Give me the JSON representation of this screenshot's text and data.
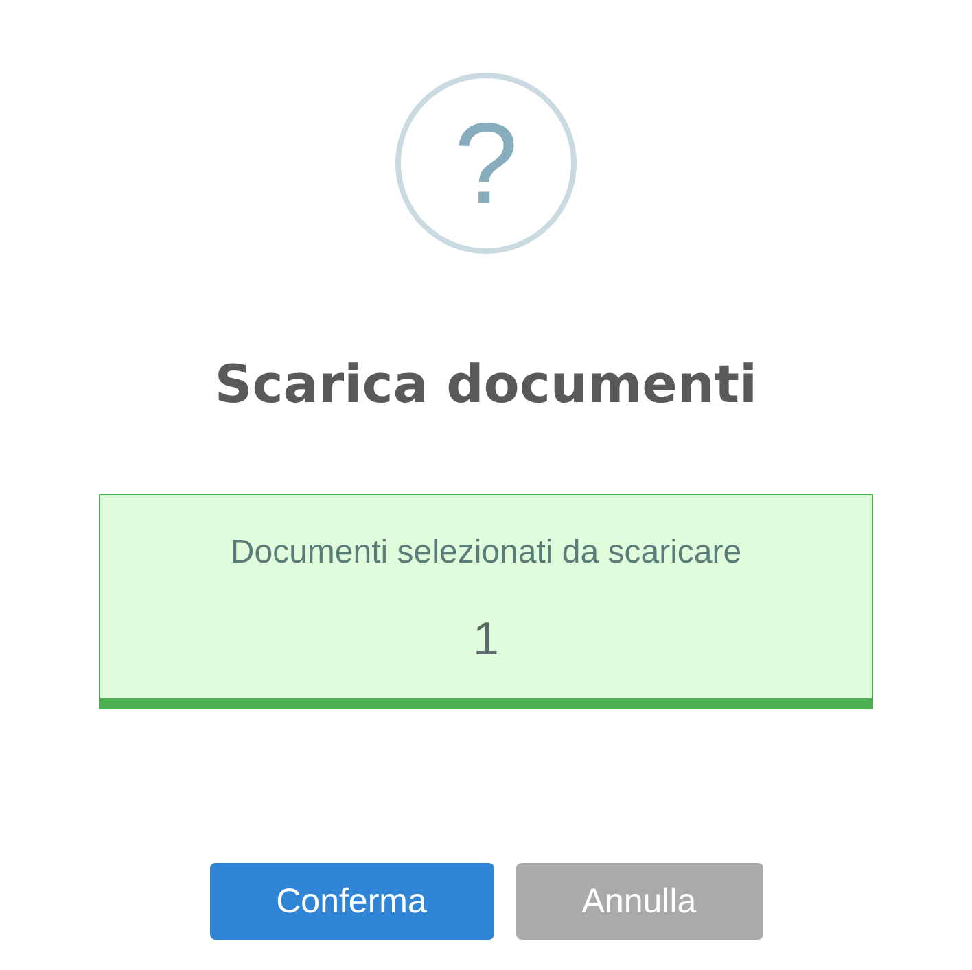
{
  "dialog": {
    "icon": "?",
    "title": "Scarica documenti",
    "info_box": {
      "label": "Documenti selezionati da scaricare",
      "count": "1"
    },
    "buttons": [
      {
        "label": "Conferma",
        "kind": "primary"
      },
      {
        "label": "Annulla",
        "kind": "secondary"
      }
    ]
  }
}
